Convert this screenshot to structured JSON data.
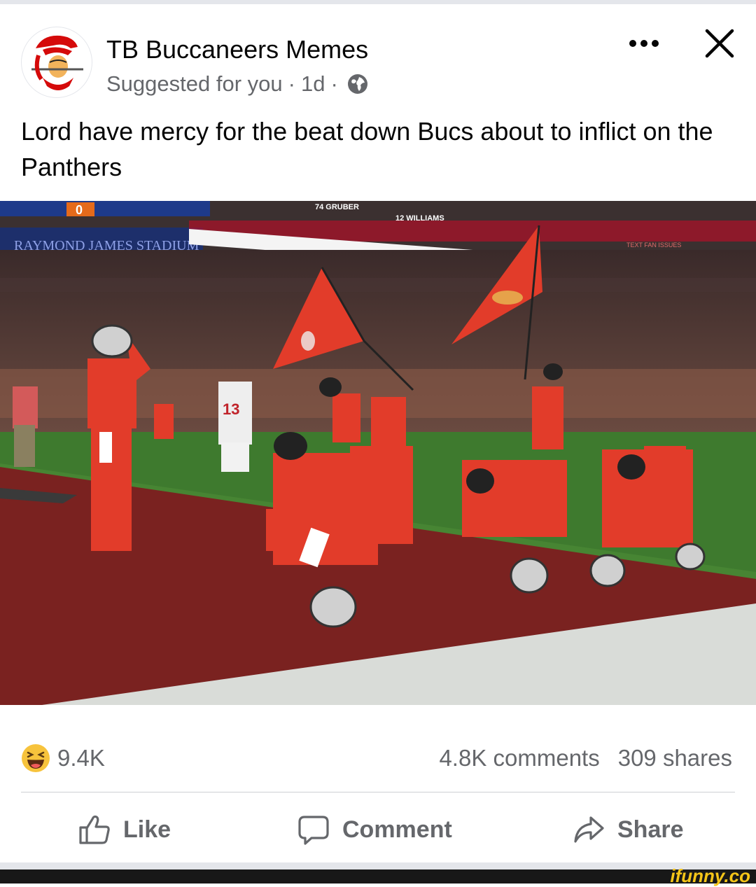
{
  "post": {
    "author": "TB Buccaneers Memes",
    "suggested": "Suggested for you",
    "separator": "·",
    "age": "1d",
    "caption": "Lord have mercy for the beat down Bucs about to inflict on the Panthers"
  },
  "photo": {
    "board_texts": [
      "0",
      "74 GRUBER",
      "12 WILLIAMS",
      "RAYMOND JAMES STADIUM",
      "TEXT FAN ISSUES"
    ],
    "jersey_number": "13"
  },
  "engagement": {
    "reaction_emoji": "laughing",
    "reaction_count": "9.4K",
    "comments": "4.8K comments",
    "shares": "309 shares"
  },
  "actions": {
    "like": "Like",
    "comment": "Comment",
    "share": "Share"
  },
  "watermark": "ifunny.co",
  "colors": {
    "accent_red": "#d50a0a",
    "meta_gray": "#65676b",
    "field_green": "#3e7a2e"
  }
}
